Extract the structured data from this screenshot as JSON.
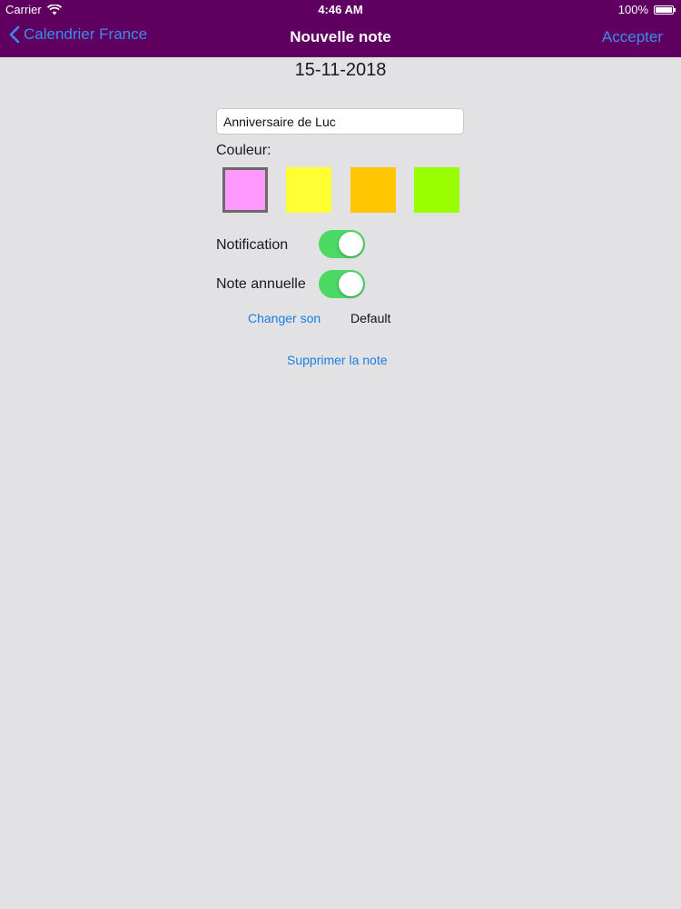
{
  "status_bar": {
    "carrier": "Carrier",
    "time": "4:46 AM",
    "battery": "100%"
  },
  "nav": {
    "back_label": "Calendrier France",
    "title": "Nouvelle note",
    "accept_label": "Accepter"
  },
  "date": "15-11-2018",
  "note": {
    "title_value": "Anniversaire de Luc"
  },
  "color": {
    "label": "Couleur:",
    "swatches": [
      "#ff99ff",
      "#ffff33",
      "#ffc500",
      "#99ff00"
    ],
    "selected_index": 0
  },
  "notification": {
    "label": "Notification",
    "on": true
  },
  "annual": {
    "label": "Note annuelle",
    "on": true
  },
  "sound": {
    "change_label": "Changer son",
    "value": "Default"
  },
  "delete_label": "Supprimer la note",
  "colors": {
    "nav_bg": "#5f0060",
    "accent": "#3b8af0",
    "toggle_on": "#4cd964",
    "background": "#e2e2e4"
  }
}
